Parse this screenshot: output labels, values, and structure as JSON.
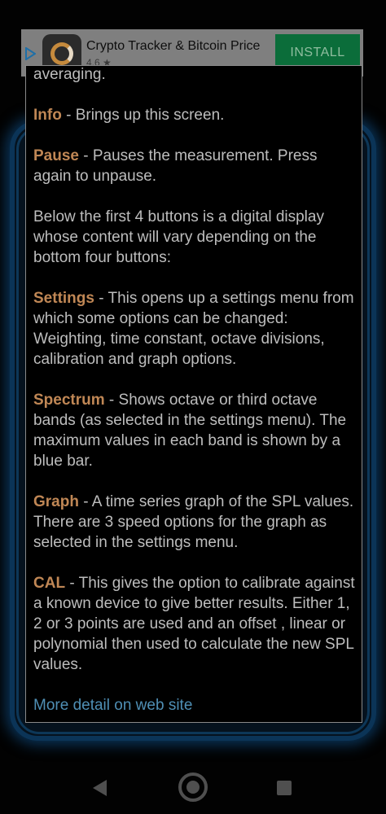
{
  "ad": {
    "title": "Crypto Tracker & Bitcoin Price",
    "rating": "4.6 ★",
    "install_label": "INSTALL"
  },
  "dialog": {
    "intro_tail": "averaging.",
    "info": {
      "term": "Info",
      "text": " - Brings up this screen."
    },
    "pause": {
      "term": "Pause",
      "text": " - Pauses the measurement. Press again to unpause."
    },
    "display_note": "Below the first 4 buttons is a digital display whose content will vary depending on the bottom four buttons:",
    "settings": {
      "term": "Settings",
      "text": " - This opens up a settings menu from which some options can be changed: Weighting, time constant, octave divisions, calibration and graph options."
    },
    "spectrum": {
      "term": "Spectrum",
      "text": " - Shows octave or third octave bands (as selected in the settings menu). The maximum values in each band is shown by a blue bar."
    },
    "graph": {
      "term": "Graph",
      "text": " - A time series graph of the SPL values. There are 3 speed options for the graph as selected in the settings menu."
    },
    "cal": {
      "term": "CAL",
      "text": " - This gives the option to calibrate against a known device to give better results. Either 1, 2 or 3 points are used and an offset , linear or polynomial then used to calculate the new SPL values."
    },
    "more_link": "More detail on web site"
  },
  "colors": {
    "term": "#c08755",
    "body_text": "#bdbdbd",
    "link": "#4f8fb5",
    "install_button": "#0b6d3a"
  }
}
